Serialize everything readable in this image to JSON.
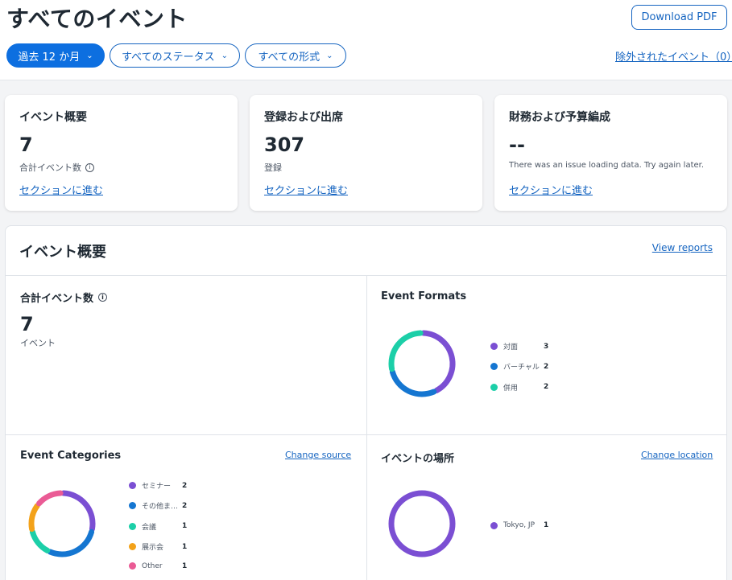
{
  "header": {
    "title": "すべてのイベント",
    "download_label": "Download PDF",
    "filters": [
      "過去 12 か月",
      "すべてのステータス",
      "すべての形式"
    ],
    "excluded_link": "除外されたイベント（0）"
  },
  "cards": [
    {
      "title": "イベント概要",
      "value": "7",
      "sub": "合計イベント数",
      "link": "セクションに進む"
    },
    {
      "title": "登録および出席",
      "value": "307",
      "sub": "登録",
      "link": "セクションに進む"
    },
    {
      "title": "財務および予算編成",
      "value": "--",
      "sub": "There was an issue loading data. Try again later.",
      "link": "セクションに進む"
    }
  ],
  "overview": {
    "title": "イベント概要",
    "view_reports": "View reports",
    "total": {
      "title": "合計イベント数",
      "value": "7",
      "unit": "イベント"
    },
    "formats": {
      "title": "Event Formats",
      "chart_data": {
        "type": "pie",
        "donut": true,
        "labels": [
          "対面",
          "バーチャル",
          "併用"
        ],
        "values": [
          3,
          2,
          2
        ],
        "colors": [
          "#7b4fd3",
          "#1576d1",
          "#1ccfa8"
        ]
      }
    },
    "categories": {
      "title": "Event Categories",
      "link": "Change source",
      "chart_data": {
        "type": "pie",
        "donut": true,
        "labels": [
          "セミナー",
          "その他ま…",
          "会議",
          "展示会",
          "Other"
        ],
        "values": [
          2,
          2,
          1,
          1,
          1
        ],
        "colors": [
          "#7b4fd3",
          "#1576d1",
          "#1ccfa8",
          "#f3a21a",
          "#ea5b95"
        ]
      }
    },
    "locations": {
      "title": "イベントの場所",
      "link": "Change location",
      "chart_data": {
        "type": "pie",
        "donut": true,
        "labels": [
          "Tokyo, JP"
        ],
        "values": [
          1
        ],
        "colors": [
          "#7b4fd3"
        ]
      }
    }
  }
}
